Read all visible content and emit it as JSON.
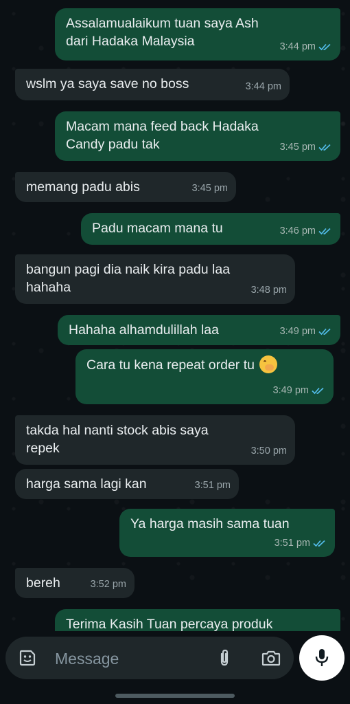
{
  "messages": [
    {
      "dir": "out",
      "text": "Assalamualaikum tuan saya Ash\ndari Hadaka Malaysia",
      "time": "3:44 pm",
      "read": true
    },
    {
      "dir": "in",
      "text": "wslm ya saya save no boss",
      "time": "3:44 pm"
    },
    {
      "dir": "out",
      "text": "Macam mana feed back Hadaka\nCandy padu tak",
      "time": "3:45 pm",
      "read": true
    },
    {
      "dir": "in",
      "text": "memang padu abis",
      "time": "3:45 pm"
    },
    {
      "dir": "out",
      "text": "Padu macam mana tu",
      "time": "3:46 pm",
      "read": true
    },
    {
      "dir": "in",
      "text": "bangun pagi dia naik kira padu laa\nhahaha",
      "time": "3:48 pm"
    },
    {
      "dir": "out",
      "text": "Hahaha alhamdulillah laa",
      "time": "3:49 pm",
      "read": true
    },
    {
      "dir": "out",
      "text": "Cara tu kena repeat order tu",
      "emoji": "hand-over-mouth-emoji",
      "time": "3:49 pm",
      "read": true
    },
    {
      "dir": "in",
      "text": "takda hal nanti stock abis saya\nrepek",
      "time": "3:50 pm"
    },
    {
      "dir": "in",
      "text": "harga sama lagi kan",
      "time": "3:51 pm"
    },
    {
      "dir": "out",
      "text": "Ya harga masih sama tuan",
      "time": "3:51 pm",
      "read": true
    },
    {
      "dir": "in",
      "text": "bereh",
      "time": "3:52 pm"
    },
    {
      "dir": "out",
      "text": "Terima Kasih Tuan percaya produk",
      "time": "",
      "read": false
    }
  ],
  "composer": {
    "placeholder": "Message",
    "icons": [
      "sticker-icon",
      "attach-icon",
      "camera-icon",
      "mic-icon"
    ]
  },
  "colors": {
    "background": "#0b1014",
    "outgoing_bubble": "#134d37",
    "incoming_bubble": "#1f272a",
    "read_ticks": "#53bdeb"
  }
}
